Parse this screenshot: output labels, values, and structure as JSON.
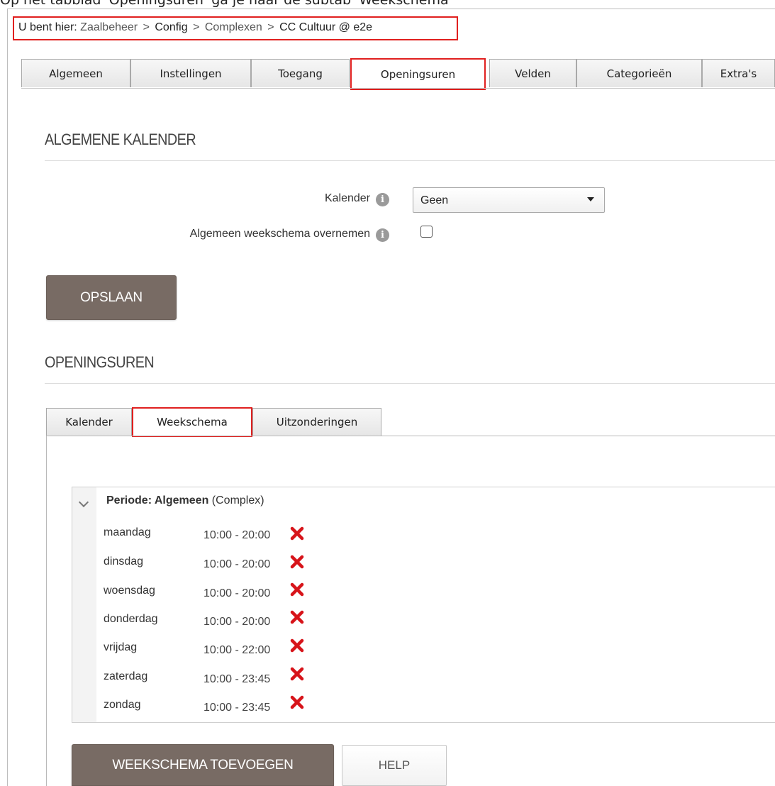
{
  "caption": "Op het tabblad 'Openingsuren' ga je naar de subtab 'Weekschema'",
  "breadcrumb": {
    "prefix": "U bent hier:",
    "items": [
      "Zaalbeheer",
      "Config",
      "Complexen",
      "CC Cultuur @ e2e"
    ],
    "separator": ">"
  },
  "main_tabs": [
    {
      "label": "Algemeen"
    },
    {
      "label": "Instellingen"
    },
    {
      "label": "Toegang"
    },
    {
      "label": "Openingsuren",
      "active": true
    },
    {
      "label": "Velden"
    },
    {
      "label": "Categorieën"
    },
    {
      "label": "Extra's"
    }
  ],
  "calendar_section": {
    "title": "ALGEMENE KALENDER",
    "kalender_label": "Kalender",
    "kalender_value": "Geen",
    "copy_schedule_label": "Algemeen weekschema overnemen",
    "copy_schedule_checked": false,
    "save_button": "OPSLAAN"
  },
  "opening_section": {
    "title": "OPENINGSUREN",
    "sub_tabs": [
      {
        "label": "Kalender"
      },
      {
        "label": "Weekschema",
        "active": true
      },
      {
        "label": "Uitzonderingen"
      }
    ],
    "period": {
      "label": "Periode: Algemeen",
      "scope": "(Complex)",
      "days": [
        {
          "day": "maandag",
          "hours": "10:00 - 20:00"
        },
        {
          "day": "dinsdag",
          "hours": "10:00 - 20:00"
        },
        {
          "day": "woensdag",
          "hours": "10:00 - 20:00"
        },
        {
          "day": "donderdag",
          "hours": "10:00 - 20:00"
        },
        {
          "day": "vrijdag",
          "hours": "10:00 - 22:00"
        },
        {
          "day": "zaterdag",
          "hours": "10:00 - 23:45"
        },
        {
          "day": "zondag",
          "hours": "10:00 - 23:45"
        }
      ]
    },
    "add_button": "WEEKSCHEMA TOEVOEGEN",
    "help_button": "HELP"
  },
  "colors": {
    "highlight": "#e0201f",
    "button_dark": "#786b64",
    "delete_icon": "#d7141a"
  }
}
